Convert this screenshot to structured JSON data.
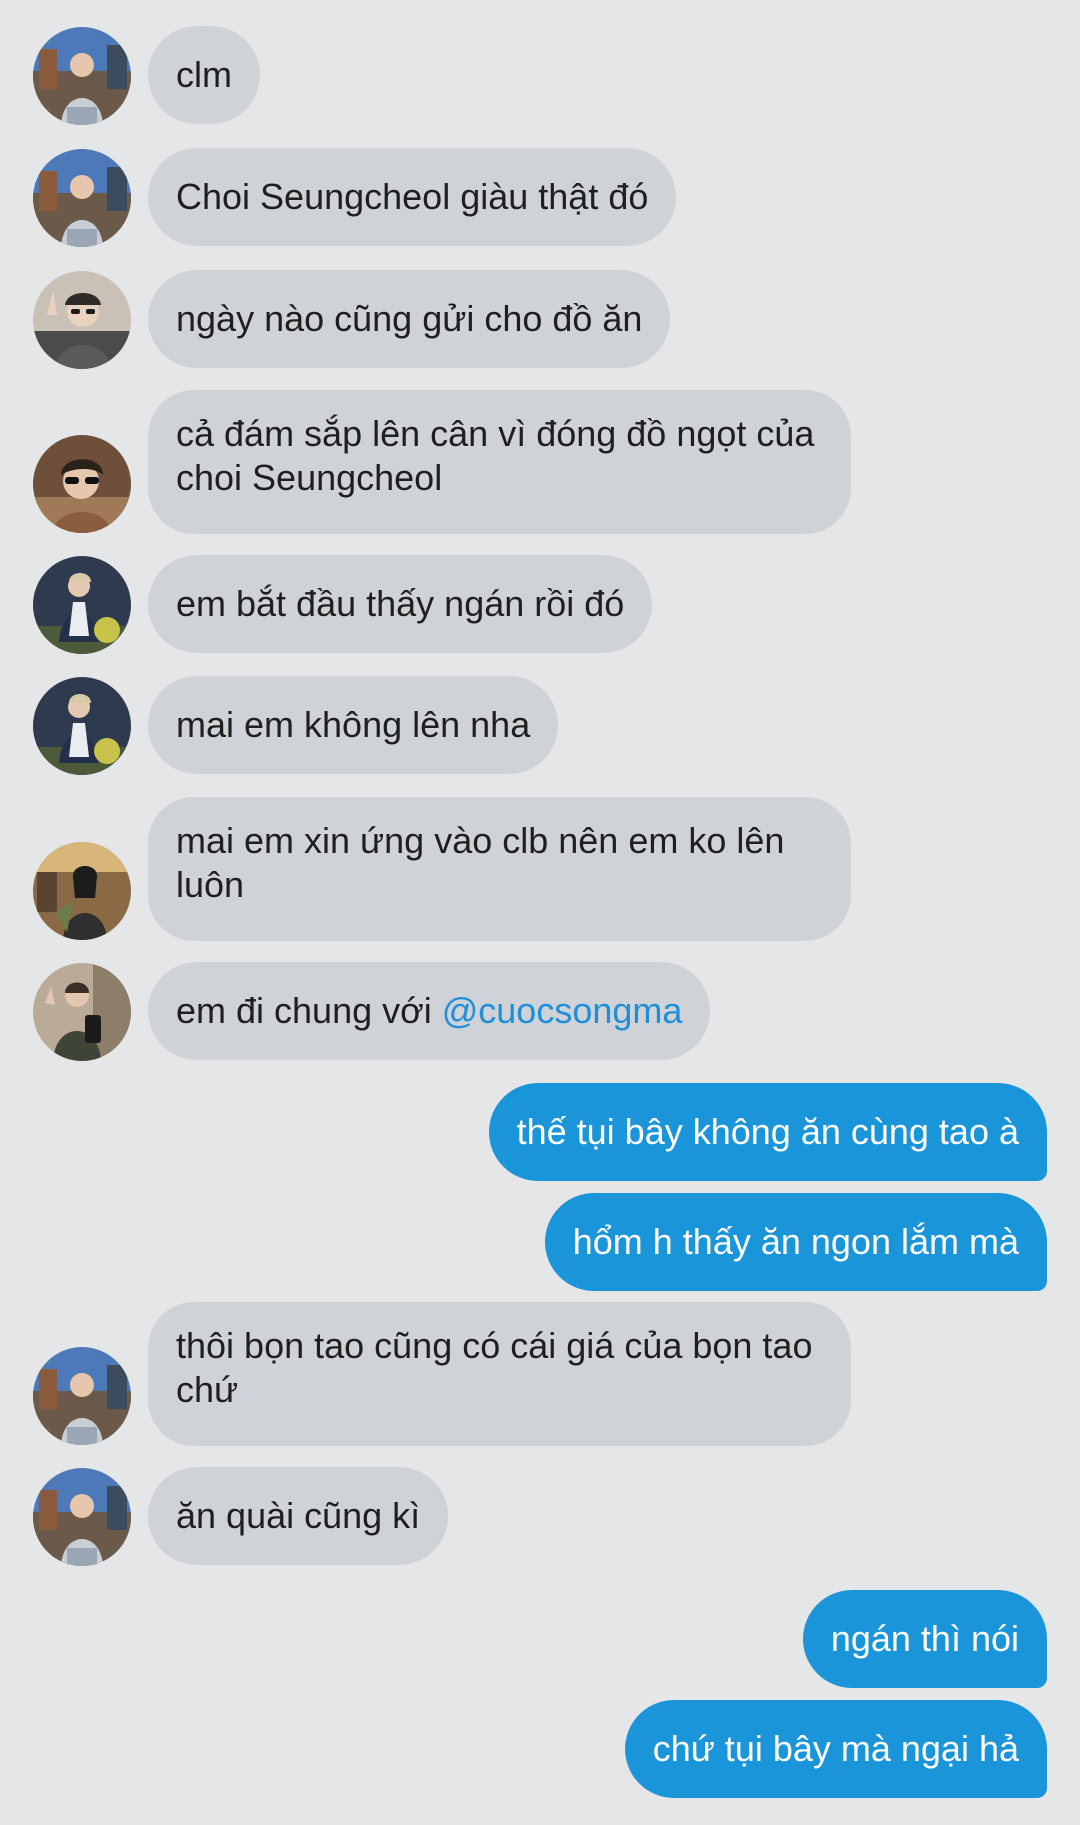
{
  "messages": [
    {
      "id": "m1",
      "side": "in",
      "avatar": "avatar-1-icon",
      "text": "clm"
    },
    {
      "id": "m2",
      "side": "in",
      "avatar": "avatar-1-icon",
      "text": "Choi Seungcheol giàu thật đó"
    },
    {
      "id": "m3",
      "side": "in",
      "avatar": "avatar-2-icon",
      "text": "ngày nào cũng gửi cho đồ ăn"
    },
    {
      "id": "m4",
      "side": "in",
      "avatar": "avatar-3-icon",
      "text": "cả đám sắp lên cân vì đóng đồ ngọt của choi Seungcheol"
    },
    {
      "id": "m5",
      "side": "in",
      "avatar": "avatar-4-icon",
      "text": "em bắt đầu thấy ngán rồi đó"
    },
    {
      "id": "m6",
      "side": "in",
      "avatar": "avatar-4-icon",
      "text": "mai em không lên nha"
    },
    {
      "id": "m7",
      "side": "in",
      "avatar": "avatar-5-icon",
      "text": "mai em xin ứng vào clb nên em ko lên luôn"
    },
    {
      "id": "m8",
      "side": "in",
      "avatar": "avatar-6-icon",
      "text": "em đi chung với ",
      "mention": "@cuocsongma"
    },
    {
      "id": "m9",
      "side": "out",
      "text": "thế tụi bây không ăn cùng tao à"
    },
    {
      "id": "m10",
      "side": "out",
      "text": "hổm h thấy ăn ngon lắm mà"
    },
    {
      "id": "m11",
      "side": "in",
      "avatar": "avatar-1-icon",
      "text": "thôi bọn tao cũng có cái giá của bọn tao chứ"
    },
    {
      "id": "m12",
      "side": "in",
      "avatar": "avatar-1-icon",
      "text": "ăn quài cũng kì"
    },
    {
      "id": "m13",
      "side": "out",
      "text": "ngán thì nói"
    },
    {
      "id": "m14",
      "side": "out",
      "text": "chứ tụi bây mà ngại hả"
    }
  ],
  "colors": {
    "background": "#e5e6e8",
    "incoming_bubble": "#cfd3d8",
    "outgoing_bubble": "#1b95da",
    "mention": "#1e8fd8"
  }
}
